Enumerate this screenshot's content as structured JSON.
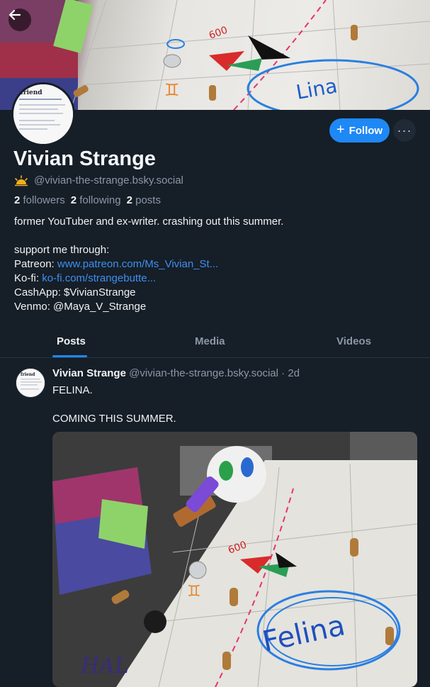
{
  "profile": {
    "name": "Vivian Strange",
    "handle": "@vivian-the-strange.bsky.social",
    "followers_count": "2",
    "followers_label": "followers",
    "following_count": "2",
    "following_label": "following",
    "posts_count": "2",
    "posts_label": "posts",
    "follow_label": "Follow",
    "more_label": "···"
  },
  "bio": {
    "line1": "former YouTuber and ex-writer. crashing out this summer.",
    "line2": "support me through:",
    "patreon_label": "Patreon: ",
    "patreon_link": "www.patreon.com/Ms_Vivian_St...",
    "kofi_label": "Ko-fi: ",
    "kofi_link": "ko-fi.com/strangebutte...",
    "cashapp": "CashApp: $VivianStrange",
    "venmo": "Venmo: @Maya_V_Strange"
  },
  "tabs": [
    {
      "label": "Posts"
    },
    {
      "label": "Media"
    },
    {
      "label": "Videos"
    }
  ],
  "post": {
    "author": "Vivian Strange",
    "handle": "@vivian-the-strange.bsky.social",
    "separator": " · ",
    "time": "2d",
    "text1": "FELINA.",
    "text2": "COMING THIS SUMMER."
  },
  "icons": {
    "back": "arrow-left-icon",
    "sun": "sunrise-icon",
    "plus": "plus-icon",
    "more": "ellipsis-icon"
  },
  "colors": {
    "accent": "#1e88f5",
    "link": "#3d8ff0",
    "background": "#161e27"
  }
}
